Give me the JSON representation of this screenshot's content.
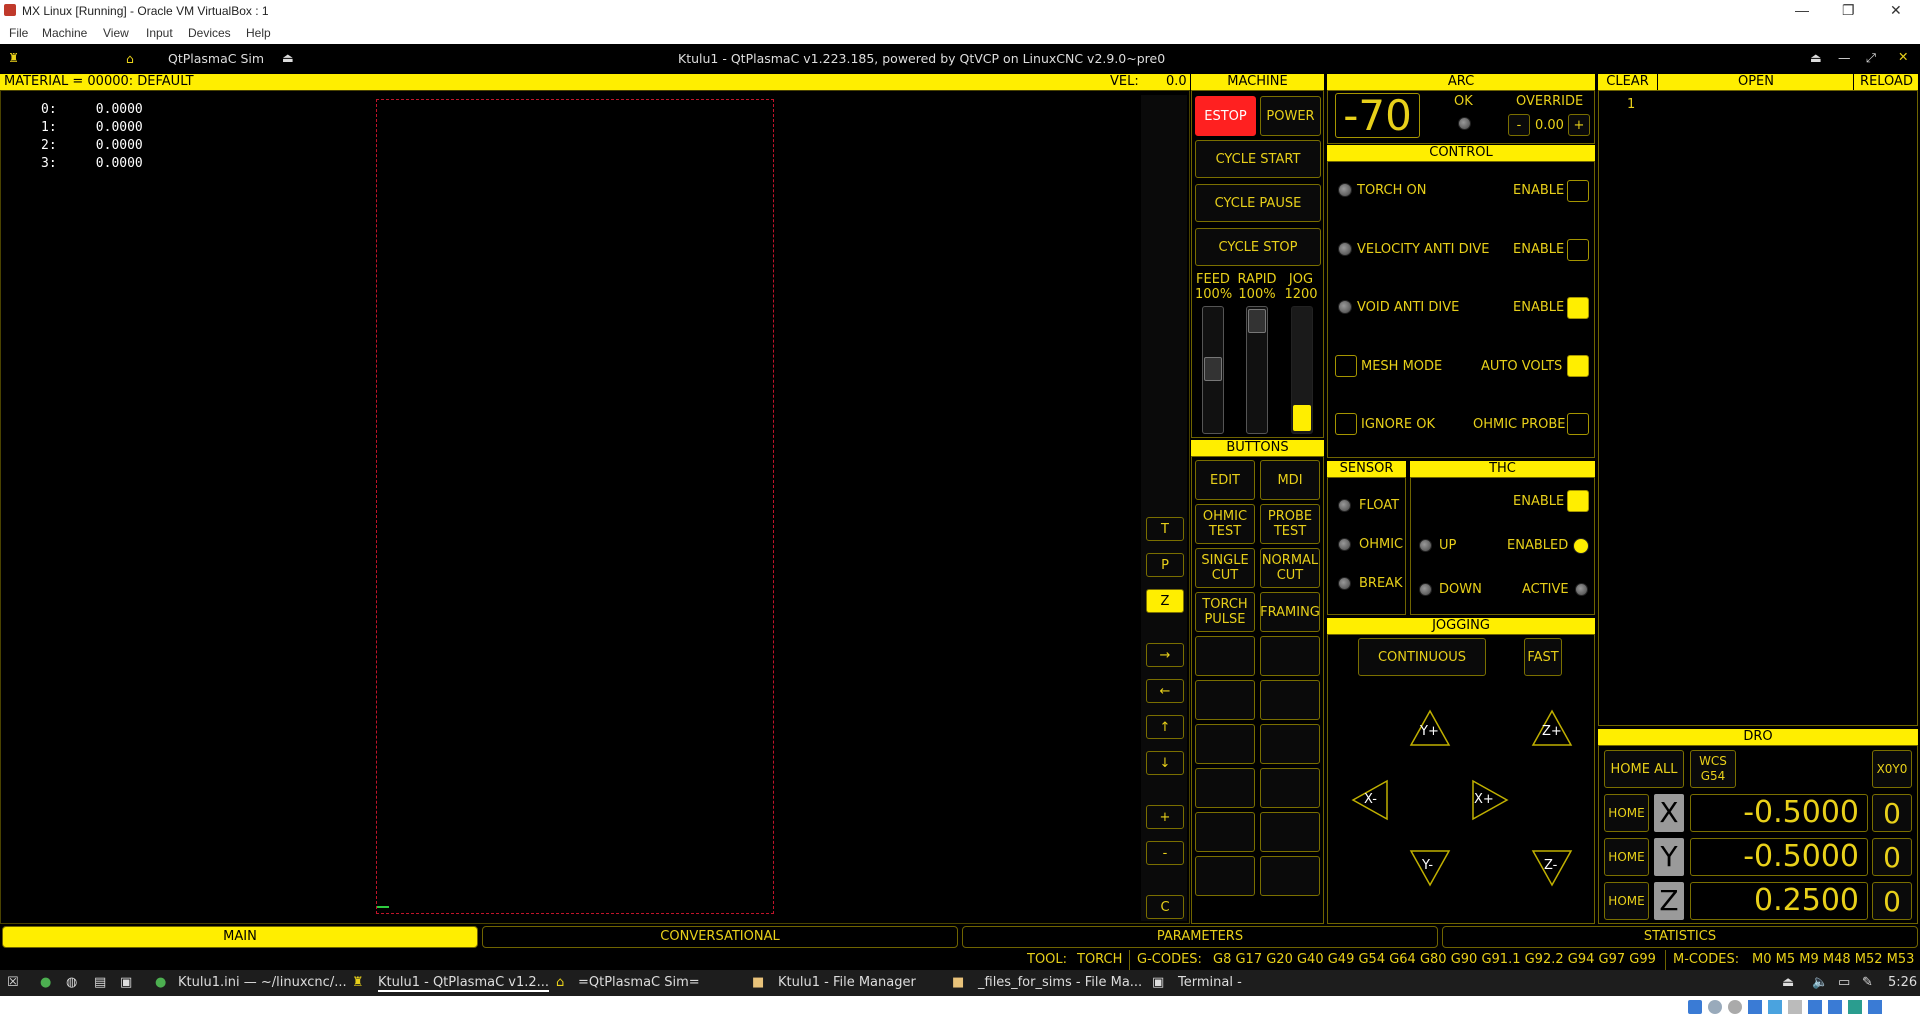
{
  "vbox": {
    "title": "MX Linux [Running] - Oracle VM VirtualBox : 1",
    "menu": [
      "File",
      "Machine",
      "View",
      "Input",
      "Devices",
      "Help"
    ]
  },
  "guestbar": {
    "app": "QtPlasmaC Sim",
    "title": "Ktulu1 - QtPlasmaC v1.223.185, powered by QtVCP on LinuxCNC v2.9.0~pre0"
  },
  "preview": {
    "material": "MATERIAL =  00000: DEFAULT",
    "vel_label": "VEL:",
    "vel_value": "0.0",
    "offsets": [
      "0:     0.0000",
      "1:     0.0000",
      "2:     0.0000",
      "3:     0.0000"
    ],
    "view_buttons": [
      "T",
      "P",
      "Z",
      "→",
      "←",
      "↑",
      "↓",
      "+",
      "-",
      "C"
    ]
  },
  "machine": {
    "header": "MACHINE",
    "estop": "ESTOP",
    "power": "POWER",
    "cycle_start": "CYCLE START",
    "cycle_pause": "CYCLE PAUSE",
    "cycle_stop": "CYCLE STOP",
    "feed_label": "FEED",
    "feed_value": "100%",
    "rapid_label": "RAPID",
    "rapid_value": "100%",
    "jog_label": "JOG",
    "jog_value": "1200"
  },
  "buttons": {
    "header": "BUTTONS",
    "items": [
      "EDIT",
      "MDI",
      "OHMIC\nTEST",
      "PROBE\nTEST",
      "SINGLE\nCUT",
      "NORMAL\nCUT",
      "TORCH\nPULSE",
      "FRAMING"
    ]
  },
  "arc": {
    "header": "ARC",
    "voltage": "-70",
    "ok_label": "OK",
    "override_label": "OVERRIDE",
    "minus": "-",
    "override_value": "0.00",
    "plus": "+"
  },
  "control": {
    "header": "CONTROL",
    "torch_on": "TORCH ON",
    "vad": "VELOCITY ANTI DIVE",
    "void": "VOID ANTI DIVE",
    "mesh": "MESH MODE",
    "ignore": "IGNORE OK",
    "enable": "ENABLE",
    "auto_volts": "AUTO VOLTS",
    "ohmic_probe": "OHMIC PROBE"
  },
  "sensor": {
    "header": "SENSOR",
    "float": "FLOAT",
    "ohmic": "OHMIC",
    "break": "BREAK"
  },
  "thc": {
    "header": "THC",
    "enable": "ENABLE",
    "up": "UP",
    "enabled": "ENABLED",
    "down": "DOWN",
    "active": "ACTIVE"
  },
  "jogging": {
    "header": "JOGGING",
    "continuous": "CONTINUOUS",
    "fast": "FAST",
    "yplus": "Y+",
    "zplus": "Z+",
    "xminus": "X-",
    "xplus": "X+",
    "yminus": "Y-",
    "zminus": "Z-"
  },
  "gcode": {
    "clear": "CLEAR",
    "open": "OPEN",
    "reload": "RELOAD",
    "line1": "1"
  },
  "dro": {
    "header": "DRO",
    "home_all": "HOME ALL",
    "wcs": "WCS\nG54",
    "x0y0": "X0Y0",
    "home": "HOME",
    "axes": [
      {
        "axis": "X",
        "value": "-0.5000",
        "zero": "0"
      },
      {
        "axis": "Y",
        "value": "-0.5000",
        "zero": "0"
      },
      {
        "axis": "Z",
        "value": "0.2500",
        "zero": "0"
      }
    ]
  },
  "tabs": [
    "MAIN",
    "CONVERSATIONAL",
    "PARAMETERS",
    "STATISTICS"
  ],
  "statusline": {
    "tool_label": "TOOL:",
    "tool": "TORCH",
    "gcodes_label": "G-CODES:",
    "gcodes": "G8 G17 G20 G40 G49 G54 G64 G80 G90 G91.1 G92.2 G94 G97 G99",
    "mcodes_label": "M-CODES:",
    "mcodes": "M0 M5 M9 M48 M52 M53"
  },
  "taskbar": {
    "items": [
      "Ktulu1.ini — ~/linuxcnc/...",
      "Ktulu1 - QtPlasmaC v1.2...",
      "=QtPlasmaC Sim=",
      "Ktulu1 - File Manager",
      "_files_for_sims - File Ma...",
      "Terminal -"
    ],
    "clock": "5:26"
  }
}
